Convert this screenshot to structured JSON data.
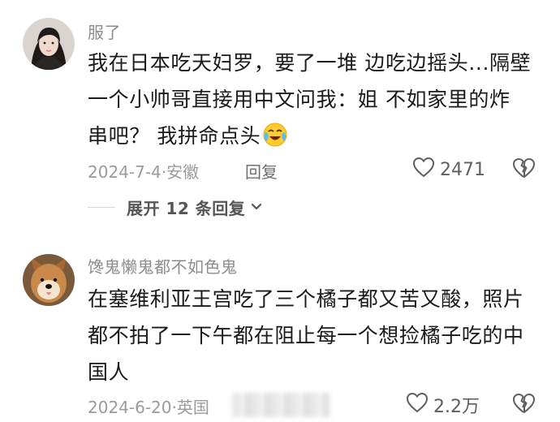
{
  "comments": [
    {
      "username": "服了",
      "text_lines": [
        "我在日本吃天妇罗，要了一堆 边吃边摇头...隔壁",
        "一个小帅哥直接用中文问我：姐  不如家里的炸",
        "串吧？   我拼命点头"
      ],
      "emoji": "crying-laughing-emoji",
      "date_location": "2024-7-4·安徽",
      "reply_label": "回复",
      "likes": "2471"
    },
    {
      "username": "馋鬼懒鬼都不如色鬼",
      "text_lines": [
        "在塞维利亚王宫吃了三个橘子都又苦又酸，照片",
        "都不拍了一下午都在阻止每一个想捡橘子吃的中",
        "国人"
      ],
      "date_location": "2024-6-20·英国",
      "likes": "2.2万"
    }
  ],
  "expand_replies": "展开 12 条回复",
  "colors": {
    "username": "#8c8c8c",
    "body_text": "#1a1a1a",
    "meta": "#9b9b9b",
    "icon": "#5f5f5f"
  }
}
